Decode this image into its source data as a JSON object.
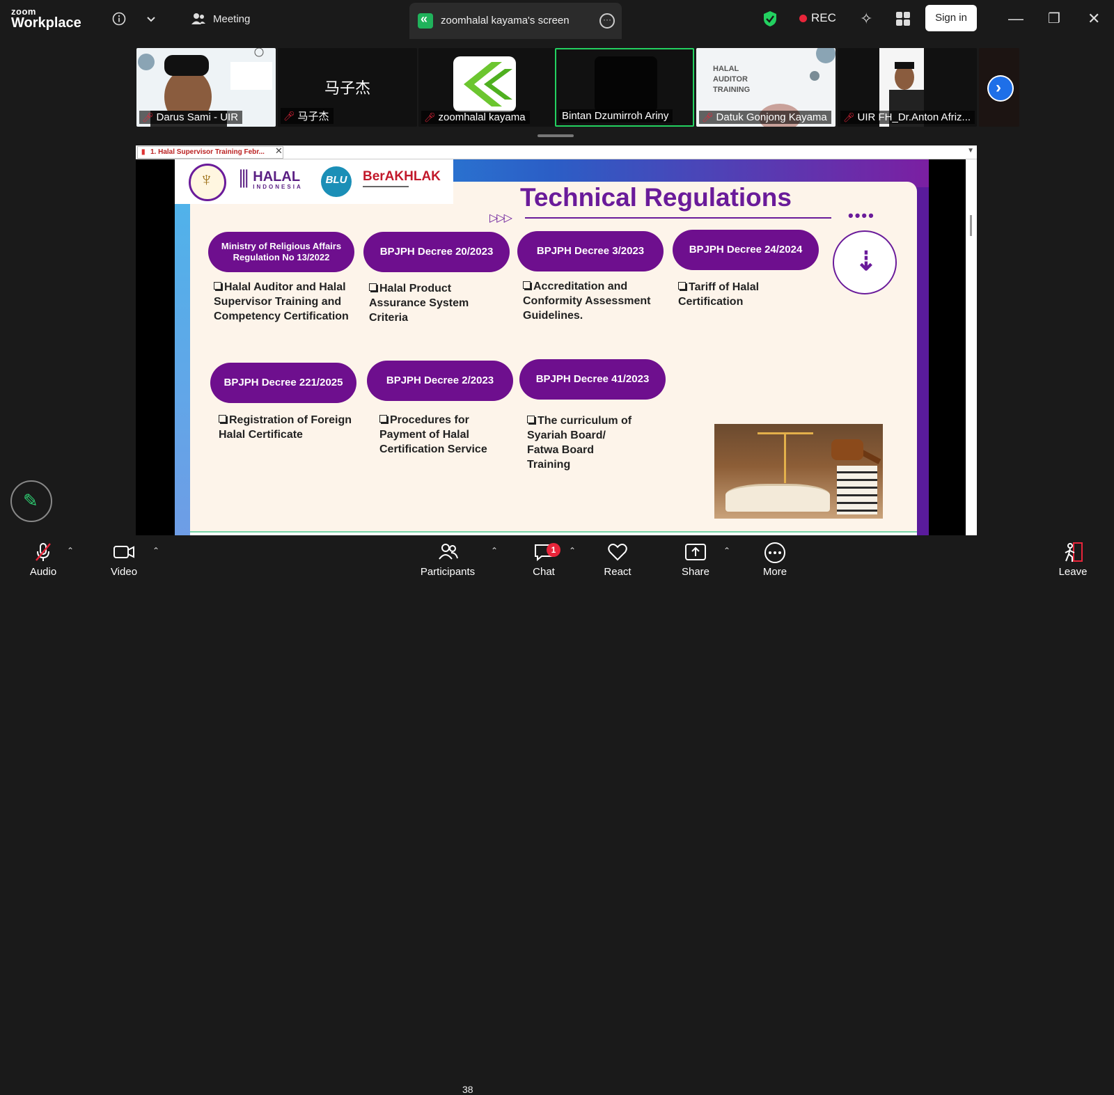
{
  "topbar": {
    "logo_line1": "zoom",
    "logo_line2": "Workplace",
    "meeting_label": "Meeting",
    "screen_tab_title": "zoomhalal kayama's screen",
    "rec_label": "REC",
    "signin_label": "Sign in",
    "accent_green": "#23d160",
    "rec_color": "#e8253a"
  },
  "participants_strip": [
    {
      "name": "Darus Sami - UIR",
      "muted": true
    },
    {
      "name": "马子杰",
      "muted": true,
      "center_text": "马子杰"
    },
    {
      "name": "zoomhalal kayama",
      "muted": true
    },
    {
      "name": "Bintan Dzumirroh Ariny",
      "muted": false,
      "active_speaker": true
    },
    {
      "name": "Datuk Gonjong Kayama",
      "muted": true
    },
    {
      "name": "UIR FH_Dr.Anton Afriz...",
      "muted": true
    }
  ],
  "pdf": {
    "tab_title": "1. Halal Supervisor Training Febr..."
  },
  "slide": {
    "title": "Technical Regulations",
    "logos": {
      "halal_main": "HALAL",
      "halal_sub": "INDONESIA",
      "blu": "BLU",
      "berakhlak": "BerAKHLAK"
    },
    "regulations": [
      {
        "pill": "Ministry of Religious Affairs Regulation No 13/2022",
        "desc": "Halal Auditor and Halal Supervisor Training and Competency Certification"
      },
      {
        "pill": "BPJPH Decree 20/2023",
        "desc": "Halal Product Assurance System Criteria"
      },
      {
        "pill": "BPJPH Decree 3/2023",
        "desc": "Accreditation and Conformity Assessment Guidelines."
      },
      {
        "pill": "BPJPH Decree 24/2024",
        "desc": "Tariff of Halal Certification"
      },
      {
        "pill": "BPJPH Decree 221/2025",
        "desc": "Registration of Foreign Halal Certificate"
      },
      {
        "pill": "BPJPH Decree 2/2023",
        "desc": "Procedures for Payment of Halal Certification Service"
      },
      {
        "pill": "BPJPH Decree 41/2023",
        "desc": "The curriculum of Syariah Board/ Fatwa Board Training"
      }
    ],
    "brand_purple": "#6e0f8e"
  },
  "toolbar": {
    "audio": "Audio",
    "video": "Video",
    "participants": "Participants",
    "participants_count": "38",
    "chat": "Chat",
    "chat_badge": "1",
    "react": "React",
    "share": "Share",
    "more": "More",
    "leave": "Leave"
  }
}
